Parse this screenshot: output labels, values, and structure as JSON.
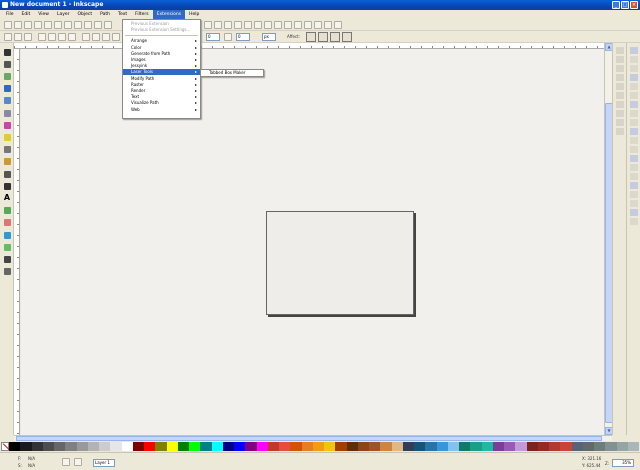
{
  "window": {
    "title": "New document 1 - Inkscape"
  },
  "menubar": [
    "File",
    "Edit",
    "View",
    "Layer",
    "Object",
    "Path",
    "Text",
    "Filters",
    "Extensions",
    "Help"
  ],
  "extensions_menu": {
    "items": [
      {
        "label": "Previous Extension",
        "disabled": true,
        "has_sub": false
      },
      {
        "label": "Previous Extension Settings...",
        "disabled": true,
        "has_sub": false
      },
      {
        "sep": true
      },
      {
        "label": "Arrange",
        "has_sub": true
      },
      {
        "label": "Color",
        "has_sub": true
      },
      {
        "label": "Generate from Path",
        "has_sub": true
      },
      {
        "label": "Images",
        "has_sub": true
      },
      {
        "label": "Jessyink",
        "has_sub": true
      },
      {
        "label": "Laser Tools",
        "has_sub": true,
        "highlight": true
      },
      {
        "label": "Modify Path",
        "has_sub": true
      },
      {
        "label": "Raster",
        "has_sub": true
      },
      {
        "label": "Render",
        "has_sub": true
      },
      {
        "label": "Text",
        "has_sub": true
      },
      {
        "label": "Visualize Path",
        "has_sub": true
      },
      {
        "label": "Web",
        "has_sub": true
      }
    ],
    "submenu": "Tabbed Box Maker"
  },
  "toolbar2": {
    "x_value": "0",
    "w_value": "0",
    "affect_label": "Affect:"
  },
  "statusbar": {
    "fill_label": "F:",
    "stroke_label": "S:",
    "fill_value": "N/A",
    "stroke_value": "N/A",
    "layer": "Layer 1",
    "coord_x": "X: 321.16",
    "coord_y": "Y: 625.44",
    "zoom_label": "Z:",
    "zoom": "35%"
  },
  "palette_colors": [
    "#000000",
    "#1a1a1a",
    "#333333",
    "#4d4d4d",
    "#666666",
    "#808080",
    "#999999",
    "#b3b3b3",
    "#cccccc",
    "#e6e6e6",
    "#ffffff",
    "#800000",
    "#ff0000",
    "#808000",
    "#ffff00",
    "#008000",
    "#00ff00",
    "#008080",
    "#00ffff",
    "#000080",
    "#0000ff",
    "#800080",
    "#ff00ff",
    "#c0392b",
    "#e74c3c",
    "#d35400",
    "#e67e22",
    "#f39c12",
    "#f1c40f",
    "#a04000",
    "#5d2e0a",
    "#8b4513",
    "#a0522d",
    "#cd853f",
    "#deb887",
    "#2e4053",
    "#1a5276",
    "#2874a6",
    "#3498db",
    "#85c1e9",
    "#117a65",
    "#16a085",
    "#1abc9c",
    "#7d3c98",
    "#9b59b6",
    "#c39bd3",
    "#7b241c",
    "#922b21",
    "#b03a2e",
    "#cb4335",
    "#566573",
    "#616a6b",
    "#707b7c",
    "#839192",
    "#95a5a6",
    "#aab7b8"
  ]
}
